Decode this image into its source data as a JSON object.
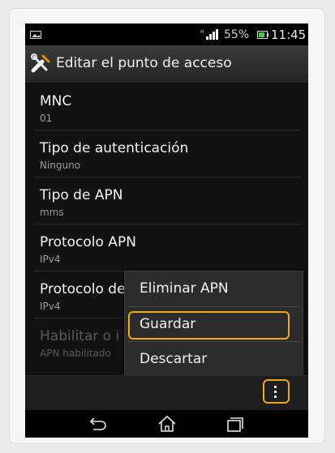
{
  "statusbar": {
    "battery_percent": "55%",
    "time": "11:45",
    "icons": [
      "image-icon",
      "signal-icon",
      "battery-icon"
    ]
  },
  "titlebar": {
    "title": "Editar el punto de acceso",
    "icon": "tools-icon"
  },
  "preferences": [
    {
      "label": "MNC",
      "value": "01"
    },
    {
      "label": "Tipo de autenticación",
      "value": "Ninguno"
    },
    {
      "label": "Tipo de APN",
      "value": "mms"
    },
    {
      "label": "Protocolo APN",
      "value": "IPv4"
    },
    {
      "label": "Protocolo de",
      "value": "IPv4"
    },
    {
      "label": "Habilitar o i",
      "value": "APN habilitado",
      "disabled": true
    }
  ],
  "menu": {
    "items": [
      {
        "label": "Eliminar APN"
      },
      {
        "label": "Guardar"
      },
      {
        "label": "Descartar"
      }
    ],
    "highlighted": "Guardar",
    "highlight_color": "#f2a818"
  },
  "actionbar": {
    "overflow_icon": "overflow-menu-icon"
  },
  "navbar": {
    "buttons": [
      "back-icon",
      "home-icon",
      "recent-apps-icon"
    ]
  }
}
